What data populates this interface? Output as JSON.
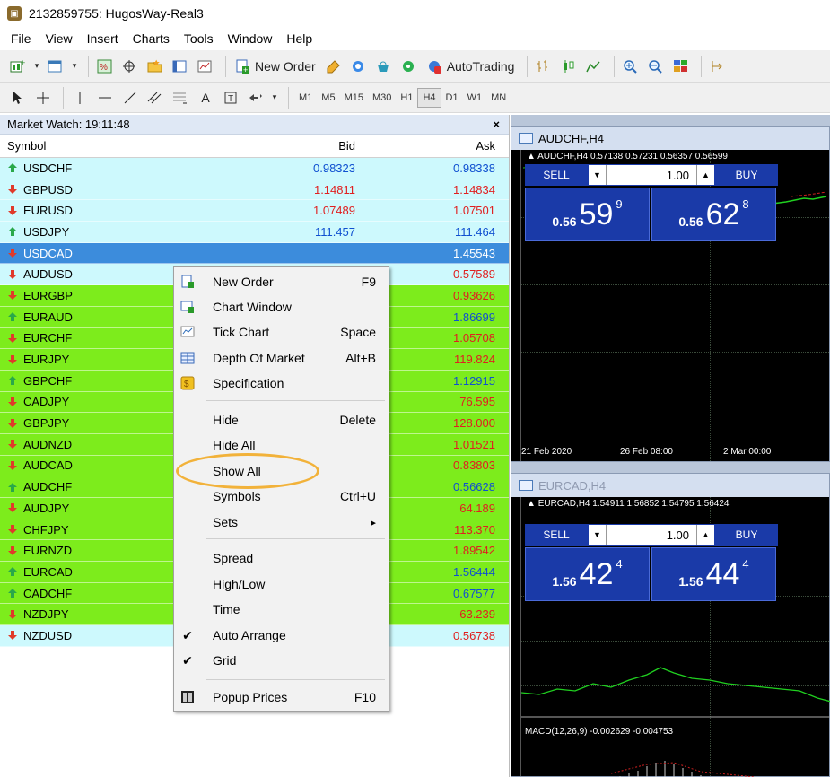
{
  "window": {
    "title": "2132859755: HugosWay-Real3"
  },
  "menu": [
    "File",
    "View",
    "Insert",
    "Charts",
    "Tools",
    "Window",
    "Help"
  ],
  "toolbar": {
    "new_order": "New Order",
    "autotrading": "AutoTrading",
    "text_tool": "A",
    "timeframes": [
      "M1",
      "M5",
      "M15",
      "M30",
      "H1",
      "H4",
      "D1",
      "W1",
      "MN"
    ],
    "active_timeframe": "H4"
  },
  "market_watch": {
    "title": "Market Watch: 19:11:48",
    "close": "×",
    "columns": {
      "symbol": "Symbol",
      "bid": "Bid",
      "ask": "Ask"
    },
    "rows": [
      {
        "symbol": "USDCHF",
        "dir": "up",
        "bid": "0.98323",
        "ask": "0.98338",
        "bg": "#cdf9fd"
      },
      {
        "symbol": "GBPUSD",
        "dir": "down",
        "bid": "1.14811",
        "ask": "1.14834",
        "bg": "#cdf9fd"
      },
      {
        "symbol": "EURUSD",
        "dir": "down",
        "bid": "1.07489",
        "ask": "1.07501",
        "bg": "#cdf9fd"
      },
      {
        "symbol": "USDJPY",
        "dir": "up",
        "bid": "111.457",
        "ask": "111.464",
        "bg": "#cdf9fd"
      },
      {
        "symbol": "USDCAD",
        "dir": "down",
        "bid": "",
        "ask": "1.45543",
        "bg": "#3c8cdc",
        "selected": true
      },
      {
        "symbol": "AUDUSD",
        "dir": "down",
        "bid": "",
        "ask": "0.57589",
        "bg": "#cdf9fd"
      },
      {
        "symbol": "EURGBP",
        "dir": "down",
        "bid": "",
        "ask": "0.93626",
        "bg": "#7dec1c"
      },
      {
        "symbol": "EURAUD",
        "dir": "up",
        "bid": "",
        "ask": "1.86699",
        "bg": "#7dec1c"
      },
      {
        "symbol": "EURCHF",
        "dir": "down",
        "bid": "",
        "ask": "1.05708",
        "bg": "#7dec1c"
      },
      {
        "symbol": "EURJPY",
        "dir": "down",
        "bid": "",
        "ask": "119.824",
        "bg": "#7dec1c"
      },
      {
        "symbol": "GBPCHF",
        "dir": "up",
        "bid": "",
        "ask": "1.12915",
        "bg": "#7dec1c"
      },
      {
        "symbol": "CADJPY",
        "dir": "down",
        "bid": "",
        "ask": "76.595",
        "bg": "#7dec1c"
      },
      {
        "symbol": "GBPJPY",
        "dir": "down",
        "bid": "",
        "ask": "128.000",
        "bg": "#7dec1c"
      },
      {
        "symbol": "AUDNZD",
        "dir": "down",
        "bid": "",
        "ask": "1.01521",
        "bg": "#7dec1c"
      },
      {
        "symbol": "AUDCAD",
        "dir": "down",
        "bid": "",
        "ask": "0.83803",
        "bg": "#7dec1c"
      },
      {
        "symbol": "AUDCHF",
        "dir": "up",
        "bid": "",
        "ask": "0.56628",
        "bg": "#7dec1c"
      },
      {
        "symbol": "AUDJPY",
        "dir": "down",
        "bid": "",
        "ask": "64.189",
        "bg": "#7dec1c"
      },
      {
        "symbol": "CHFJPY",
        "dir": "down",
        "bid": "",
        "ask": "113.370",
        "bg": "#7dec1c"
      },
      {
        "symbol": "EURNZD",
        "dir": "down",
        "bid": "",
        "ask": "1.89542",
        "bg": "#7dec1c"
      },
      {
        "symbol": "EURCAD",
        "dir": "up",
        "bid": "",
        "ask": "1.56444",
        "bg": "#7dec1c"
      },
      {
        "symbol": "CADCHF",
        "dir": "up",
        "bid": "",
        "ask": "0.67577",
        "bg": "#7dec1c"
      },
      {
        "symbol": "NZDJPY",
        "dir": "down",
        "bid": "",
        "ask": "63.239",
        "bg": "#7dec1c"
      },
      {
        "symbol": "NZDUSD",
        "dir": "down",
        "bid": "",
        "ask": "0.56738",
        "bg": "#cdf9fd"
      }
    ]
  },
  "context_menu": {
    "items": [
      {
        "label": "New Order",
        "key": "F9",
        "icon": "new-order-icon"
      },
      {
        "label": "Chart Window",
        "key": "",
        "icon": "chart-window-icon"
      },
      {
        "label": "Tick Chart",
        "key": "Space",
        "icon": "tick-chart-icon"
      },
      {
        "label": "Depth Of Market",
        "key": "Alt+B",
        "icon": "depth-of-market-icon"
      },
      {
        "label": "Specification",
        "key": "",
        "icon": "specification-icon"
      },
      {
        "label": "Hide",
        "key": "Delete"
      },
      {
        "label": "Hide All",
        "key": ""
      },
      {
        "label": "Show All",
        "key": ""
      },
      {
        "label": "Symbols",
        "key": "Ctrl+U"
      },
      {
        "label": "Sets",
        "key": ""
      },
      {
        "label": "Spread",
        "key": ""
      },
      {
        "label": "High/Low",
        "key": ""
      },
      {
        "label": "Time",
        "key": ""
      },
      {
        "label": "Auto Arrange",
        "key": "",
        "checked": true
      },
      {
        "label": "Grid",
        "key": "",
        "checked": true
      },
      {
        "label": "Popup Prices",
        "key": "F10",
        "icon": "popup-prices-icon"
      }
    ],
    "submenu_arrow": "▸",
    "check_mark": "✔"
  },
  "charts": [
    {
      "title": "AUDCHF,H4",
      "info": "AUDCHF,H4  0.57138 0.57231 0.56357 0.56599",
      "sell": "SELL",
      "buy": "BUY",
      "lot": "1.00",
      "sell_prefix": "0.56",
      "sell_big": "59",
      "sell_sup": "9",
      "buy_prefix": "0.56",
      "buy_big": "62",
      "buy_sup": "8",
      "time_labels": [
        "21 Feb 2020",
        "26 Feb 08:00",
        "2 Mar 00:00"
      ]
    },
    {
      "title": "EURCAD,H4",
      "info": "EURCAD,H4  1.54911 1.56852 1.54795 1.56424",
      "sell": "SELL",
      "buy": "BUY",
      "lot": "1.00",
      "sell_prefix": "1.56",
      "sell_big": "42",
      "sell_sup": "4",
      "buy_prefix": "1.56",
      "buy_big": "44",
      "buy_sup": "4",
      "indicator": "MACD(12,26,9) -0.002629 -0.004753"
    }
  ]
}
